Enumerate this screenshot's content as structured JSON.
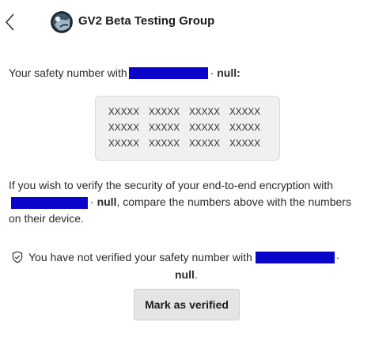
{
  "header": {
    "back_icon": "chevron-left-icon",
    "avatar_icon": "group-avatar-icon",
    "title": "GV2 Beta Testing Group"
  },
  "safety": {
    "prefix": "Your safety number with",
    "suffix_dot": "·",
    "suffix_name": "null",
    "colon": ":"
  },
  "number_box": {
    "rows": [
      [
        "XXXXX",
        "XXXXX",
        "XXXXX",
        "XXXXX"
      ],
      [
        "XXXXX",
        "XXXXX",
        "XXXXX",
        "XXXXX"
      ],
      [
        "XXXXX",
        "XXXXX",
        "XXXXX",
        "XXXXX"
      ]
    ]
  },
  "paragraph": {
    "part1": "If you wish to verify the security of your end-to-end encryption with",
    "dot": "·",
    "name": "null",
    "part2": ", compare the numbers above with the numbers on their device."
  },
  "status": {
    "icon": "shield-check-icon",
    "text": "You have not verified your safety number with",
    "dot": "·",
    "name": "null",
    "period": "."
  },
  "actions": {
    "verify_label": "Mark as verified"
  },
  "colors": {
    "redaction": "#0a05c9",
    "number_box_bg": "#f0f0f0",
    "button_bg": "#e4e4e4"
  }
}
